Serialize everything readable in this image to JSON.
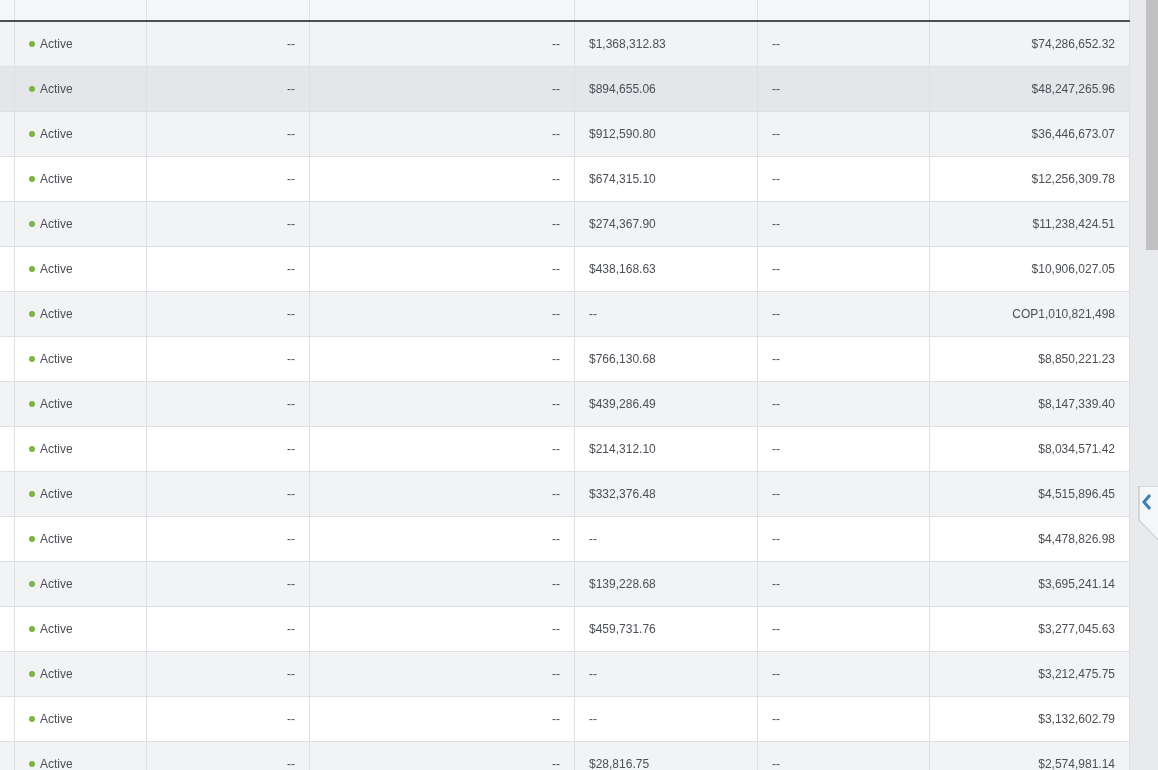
{
  "table": {
    "rows": [
      {
        "status": "Active",
        "color": "#7cb342",
        "hovered": false,
        "spend_cap": "--",
        "spend_cap_remaining": "--",
        "credit_used": "$1,368,312.83",
        "credit_left": "--",
        "spent": "$74,286,652.32"
      },
      {
        "status": "Active",
        "color": "#7cb342",
        "hovered": true,
        "spend_cap": "--",
        "spend_cap_remaining": "--",
        "credit_used": "$894,655.06",
        "credit_left": "--",
        "spent": "$48,247,265.96"
      },
      {
        "status": "Active",
        "color": "#7cb342",
        "hovered": false,
        "spend_cap": "--",
        "spend_cap_remaining": "--",
        "credit_used": "$912,590.80",
        "credit_left": "--",
        "spent": "$36,446,673.07"
      },
      {
        "status": "Active",
        "color": "#7cb342",
        "hovered": false,
        "spend_cap": "--",
        "spend_cap_remaining": "--",
        "credit_used": "$674,315.10",
        "credit_left": "--",
        "spent": "$12,256,309.78"
      },
      {
        "status": "Active",
        "color": "#7cb342",
        "hovered": false,
        "spend_cap": "--",
        "spend_cap_remaining": "--",
        "credit_used": "$274,367.90",
        "credit_left": "--",
        "spent": "$11,238,424.51"
      },
      {
        "status": "Active",
        "color": "#7cb342",
        "hovered": false,
        "spend_cap": "--",
        "spend_cap_remaining": "--",
        "credit_used": "$438,168.63",
        "credit_left": "--",
        "spent": "$10,906,027.05"
      },
      {
        "status": "Active",
        "color": "#7cb342",
        "hovered": false,
        "spend_cap": "--",
        "spend_cap_remaining": "--",
        "credit_used": "--",
        "credit_left": "--",
        "spent": "COP1,010,821,498"
      },
      {
        "status": "Active",
        "color": "#7cb342",
        "hovered": false,
        "spend_cap": "--",
        "spend_cap_remaining": "--",
        "credit_used": "$766,130.68",
        "credit_left": "--",
        "spent": "$8,850,221.23"
      },
      {
        "status": "Active",
        "color": "#7cb342",
        "hovered": false,
        "spend_cap": "--",
        "spend_cap_remaining": "--",
        "credit_used": "$439,286.49",
        "credit_left": "--",
        "spent": "$8,147,339.40"
      },
      {
        "status": "Active",
        "color": "#7cb342",
        "hovered": false,
        "spend_cap": "--",
        "spend_cap_remaining": "--",
        "credit_used": "$214,312.10",
        "credit_left": "--",
        "spent": "$8,034,571.42"
      },
      {
        "status": "Active",
        "color": "#7cb342",
        "hovered": false,
        "spend_cap": "--",
        "spend_cap_remaining": "--",
        "credit_used": "$332,376.48",
        "credit_left": "--",
        "spent": "$4,515,896.45"
      },
      {
        "status": "Active",
        "color": "#7cb342",
        "hovered": false,
        "spend_cap": "--",
        "spend_cap_remaining": "--",
        "credit_used": "--",
        "credit_left": "--",
        "spent": "$4,478,826.98"
      },
      {
        "status": "Active",
        "color": "#7cb342",
        "hovered": false,
        "spend_cap": "--",
        "spend_cap_remaining": "--",
        "credit_used": "$139,228.68",
        "credit_left": "--",
        "spent": "$3,695,241.14"
      },
      {
        "status": "Active",
        "color": "#7cb342",
        "hovered": false,
        "spend_cap": "--",
        "spend_cap_remaining": "--",
        "credit_used": "$459,731.76",
        "credit_left": "--",
        "spent": "$3,277,045.63"
      },
      {
        "status": "Active",
        "color": "#7cb342",
        "hovered": false,
        "spend_cap": "--",
        "spend_cap_remaining": "--",
        "credit_used": "--",
        "credit_left": "--",
        "spent": "$3,212,475.75"
      },
      {
        "status": "Active",
        "color": "#7cb342",
        "hovered": false,
        "spend_cap": "--",
        "spend_cap_remaining": "--",
        "credit_used": "--",
        "credit_left": "--",
        "spent": "$3,132,602.79"
      },
      {
        "status": "Active",
        "color": "#7cb342",
        "hovered": false,
        "spend_cap": "--",
        "spend_cap_remaining": "--",
        "credit_used": "$28,816.75",
        "credit_left": "--",
        "spent": "$2,574,981.14"
      }
    ]
  }
}
